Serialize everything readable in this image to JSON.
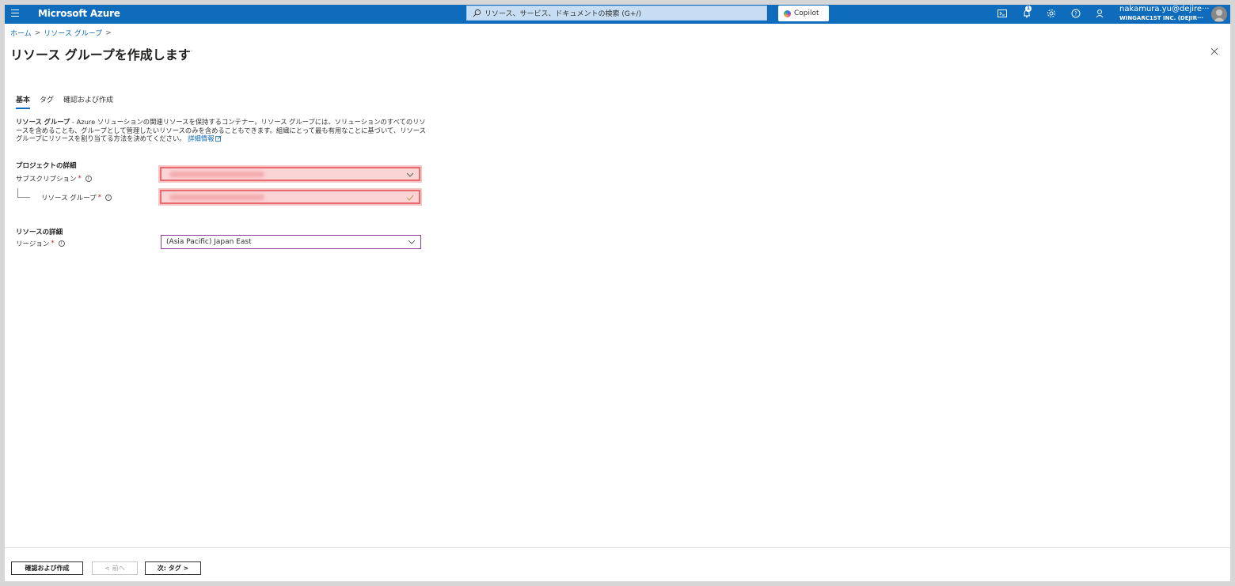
{
  "topbar": {
    "brand": "Microsoft Azure",
    "search_placeholder": "リソース、サービス、ドキュメントの検索 (G+/)",
    "copilot_label": "Copilot",
    "notification_count": "1",
    "account_name": "nakamura.yu@dejire···",
    "account_org": "WINGARC1ST INC. (DEJIR···"
  },
  "breadcrumb": {
    "home": "ホーム",
    "resource_groups": "リソース グループ",
    "sep": ">"
  },
  "page": {
    "title": "リソース グループを作成します",
    "more": "···",
    "close_symbol": "✕"
  },
  "tabs": [
    "基本",
    "タグ",
    "確認および作成"
  ],
  "description": {
    "bold": "リソース グループ",
    "text": " - Azure ソリューションの関連リソースを保持するコンテナー。リソース グループには、ソリューションのすべてのリソースを含めることも、グループとして管理したいリソースのみを含めることもできます。組織にとって最も有用なことに基づいて、リソース グループにリソースを割り当てる方法を決めてください。",
    "link": "詳細情報"
  },
  "project": {
    "heading": "プロジェクトの詳細",
    "subscription_label": "サブスクリプション",
    "resource_group_label": "リソース グループ",
    "required_mark": "*"
  },
  "resource": {
    "heading": "リソースの詳細",
    "region_label": "リージョン",
    "region_value": "(Asia Pacific) Japan East"
  },
  "footer": {
    "review_create": "確認および作成",
    "previous": "< 前へ",
    "next": "次: タグ >"
  },
  "colors": {
    "accent": "#0f6cbd",
    "highlight_border": "#e96b6f",
    "required": "#a4262c"
  }
}
